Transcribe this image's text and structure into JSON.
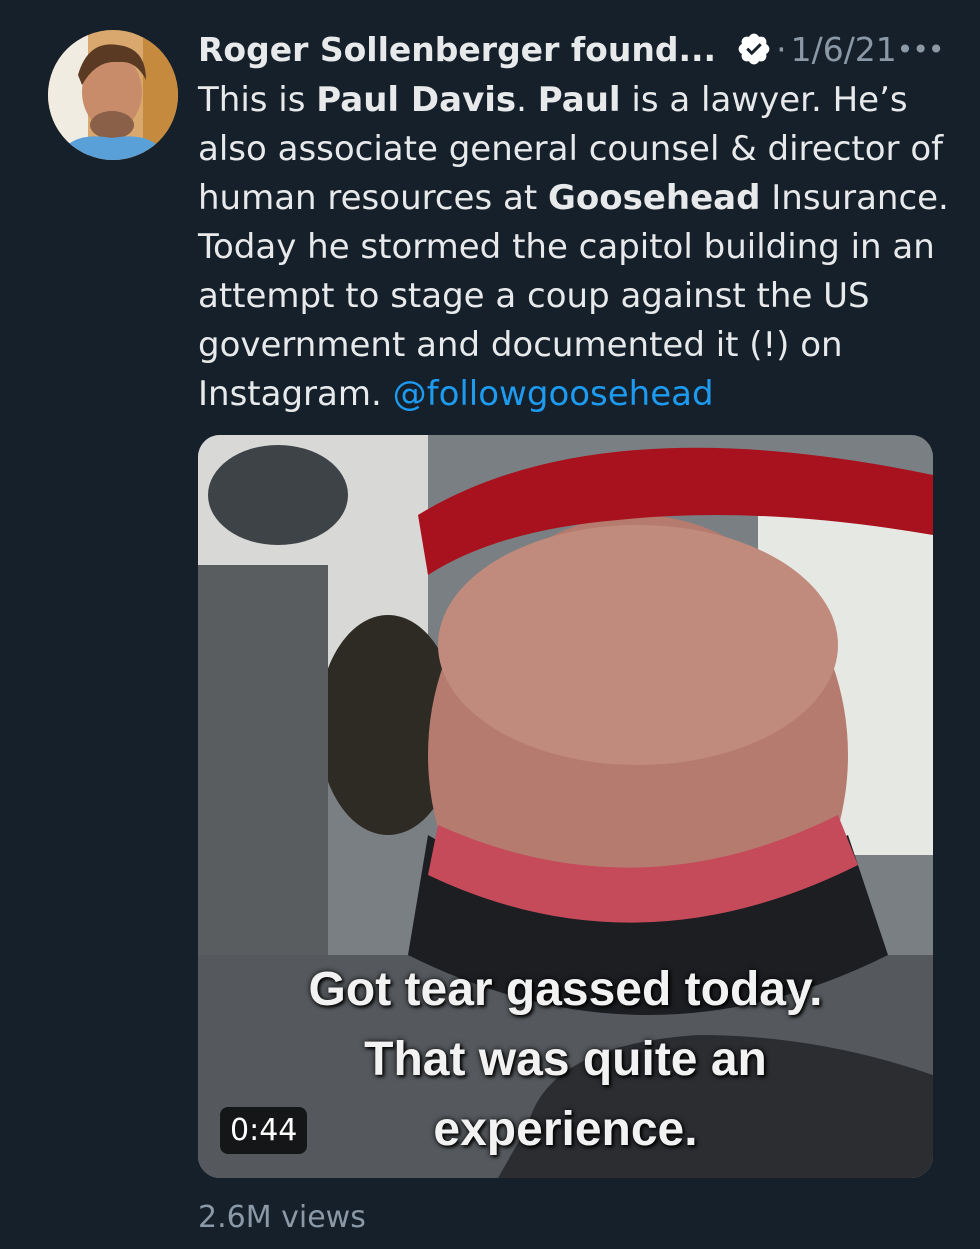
{
  "tweet": {
    "author": "Roger Sollenberger found...",
    "separator": "·",
    "date": "1/6/21",
    "more": "•••",
    "text": {
      "p1": "This is ",
      "name1": "Paul Davis",
      "p2": ". ",
      "name2": "Paul",
      "p3": " is a lawyer. He’s also associate general counsel & director of human resources at ",
      "company": "Goosehead",
      "p4": " Insurance. Today he stormed the capitol building in an attempt to stage a coup against the US government and documented it (!) on Instagram. ",
      "mention": "@followgoosehead"
    },
    "media": {
      "caption_line1": "Got tear gassed today.",
      "caption_line2": "That was quite an",
      "caption_line3": "experience.",
      "duration": "0:44"
    },
    "views": "2.6M views"
  },
  "colors": {
    "background": "#15202b",
    "text": "#e7e9ea",
    "muted": "#8b98a5",
    "link": "#1d9bf0"
  },
  "icons": {
    "verified": "verified-badge-icon",
    "more": "more-options-icon"
  }
}
